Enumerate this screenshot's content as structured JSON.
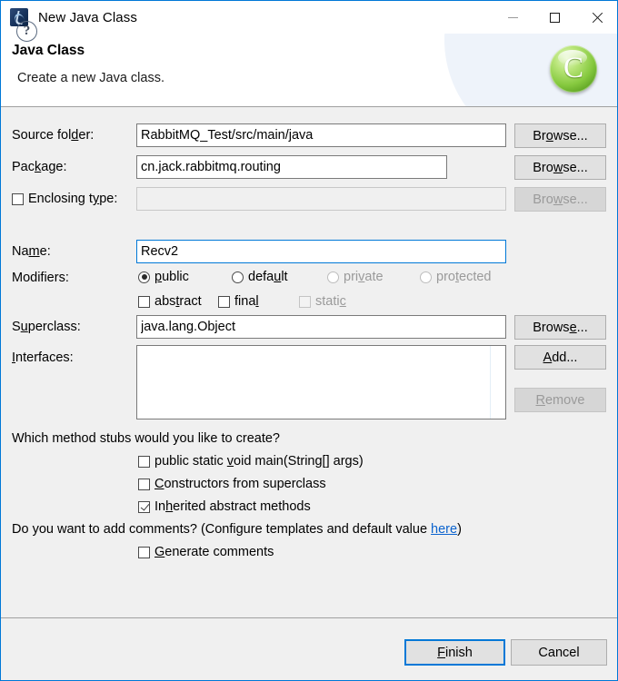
{
  "window": {
    "title": "New Java Class",
    "icon": "eclipse-java-icon",
    "controls": {
      "minimize": "minimize-icon",
      "maximize": "maximize-icon",
      "close": "close-icon"
    }
  },
  "header": {
    "title": "Java Class",
    "subtitle": "Create a new Java class.",
    "badge_glyph": "C"
  },
  "form": {
    "source_folder": {
      "label_pre": "Source fol",
      "label_mnemonic": "d",
      "label_post": "er:",
      "value": "RabbitMQ_Test/src/main/java",
      "browse_pre": "Br",
      "browse_mnemonic": "o",
      "browse_post": "wse..."
    },
    "package": {
      "label_pre": "Pac",
      "label_mnemonic": "k",
      "label_post": "age:",
      "value": "cn.jack.rabbitmq.routing",
      "browse_pre": "Bro",
      "browse_mnemonic": "w",
      "browse_post": "se..."
    },
    "enclosing_type": {
      "label_pre": "Enclosing t",
      "label_mnemonic": "y",
      "label_post": "pe:",
      "value": "",
      "checked": false,
      "browse_pre": "Bro",
      "browse_mnemonic": "w",
      "browse_post": "se..."
    },
    "name": {
      "label_pre": "Na",
      "label_mnemonic": "m",
      "label_post": "e:",
      "value": "Recv2"
    },
    "modifiers": {
      "label": "Modifiers:",
      "radios": [
        {
          "pre": "",
          "mnemonic": "p",
          "post": "ublic",
          "checked": true,
          "disabled": false
        },
        {
          "pre": "defa",
          "mnemonic": "u",
          "post": "lt",
          "checked": false,
          "disabled": false
        },
        {
          "pre": "pri",
          "mnemonic": "v",
          "post": "ate",
          "checked": false,
          "disabled": true
        },
        {
          "pre": "pro",
          "mnemonic": "t",
          "post": "ected",
          "checked": false,
          "disabled": true
        }
      ],
      "checkboxes": [
        {
          "pre": "abs",
          "mnemonic": "t",
          "post": "ract",
          "checked": false,
          "disabled": false
        },
        {
          "pre": "fina",
          "mnemonic": "l",
          "post": "",
          "checked": false,
          "disabled": false
        },
        {
          "pre": "stati",
          "mnemonic": "c",
          "post": "",
          "checked": false,
          "disabled": true
        }
      ]
    },
    "superclass": {
      "label_pre": "S",
      "label_mnemonic": "u",
      "label_post": "perclass:",
      "value": "java.lang.Object",
      "browse_pre": "Brows",
      "browse_mnemonic": "e",
      "browse_post": "..."
    },
    "interfaces": {
      "label_pre": "",
      "label_mnemonic": "I",
      "label_post": "nterfaces:",
      "items": [],
      "add_pre": "",
      "add_mnemonic": "A",
      "add_post": "dd...",
      "remove_pre": "",
      "remove_mnemonic": "R",
      "remove_post": "emove"
    }
  },
  "stubs": {
    "question": "Which method stubs would you like to create?",
    "options": [
      {
        "pre": "public static ",
        "mnemonic": "v",
        "post": "oid main(String[] args)",
        "checked": false
      },
      {
        "pre": "",
        "mnemonic": "C",
        "post": "onstructors from superclass",
        "checked": false
      },
      {
        "pre": "In",
        "mnemonic": "h",
        "post": "erited abstract methods",
        "checked": true
      }
    ]
  },
  "comments": {
    "question_pre": "Do you want to add comments? (Configure templates and default value ",
    "link": "here",
    "question_post": ")",
    "checkbox": {
      "pre": "",
      "mnemonic": "G",
      "post": "enerate comments",
      "checked": false
    }
  },
  "footer": {
    "help_icon": "?",
    "finish": {
      "pre": "",
      "mnemonic": "F",
      "post": "inish"
    },
    "cancel": "Cancel"
  },
  "colors": {
    "accent": "#0078d7",
    "dialog_bg": "#f0f0f0",
    "link": "#0b63ce",
    "badge_green": "#86c93f"
  }
}
